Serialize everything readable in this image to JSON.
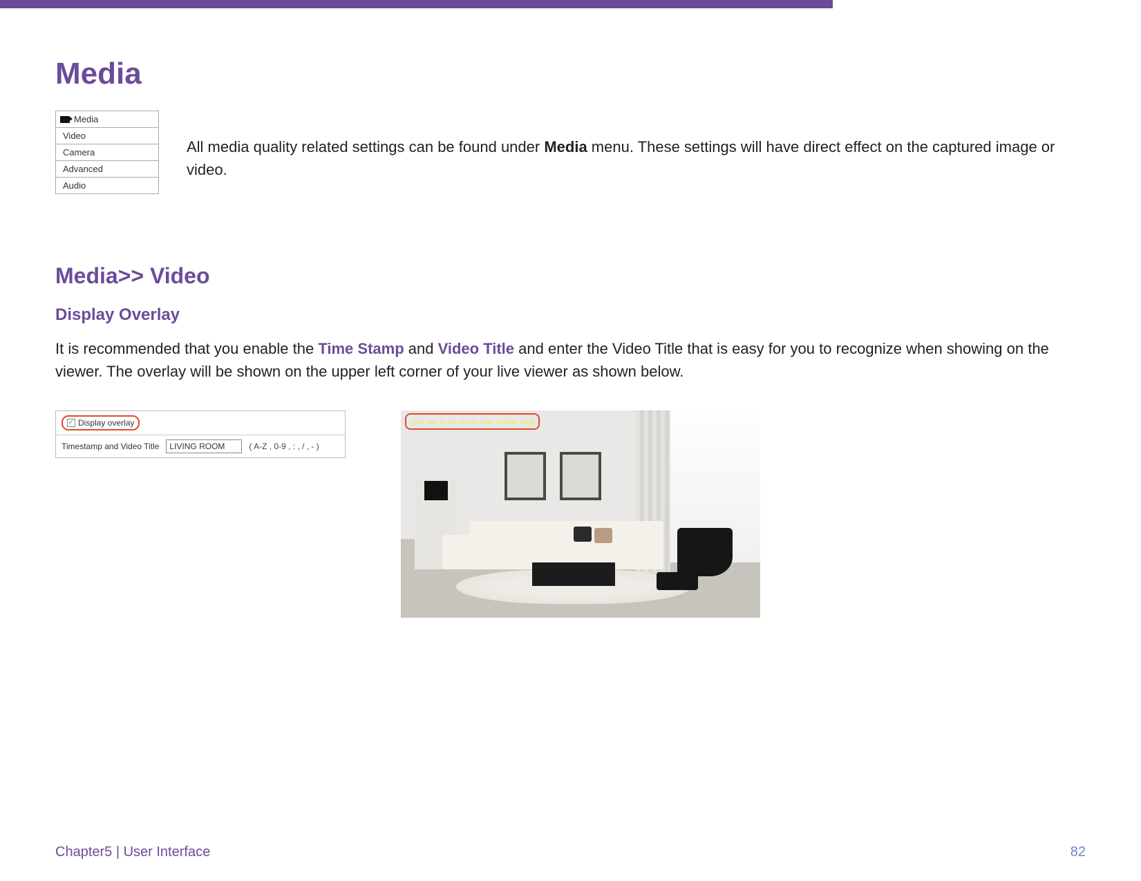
{
  "title": "Media",
  "menu": {
    "header": "Media",
    "items": [
      "Video",
      "Camera",
      "Advanced",
      "Audio"
    ]
  },
  "intro": {
    "pre": "All media quality related settings can be found under ",
    "bold": "Media",
    "post": " menu. These settings will have direct effect on the captured image or video."
  },
  "subhead": "Media>> Video",
  "section": "Display Overlay",
  "para": {
    "p1": "It is recommended that you enable the ",
    "h1": "Time Stamp",
    "p2": " and ",
    "h2": "Video Title",
    "p3": " and enter the Video Title that is easy for you to recognize when showing on the viewer. The overlay will be shown on the upper left corner of your live viewer as shown below."
  },
  "settings": {
    "checkbox_label": "Display overlay",
    "checkbox_mark": "✓",
    "row_label": "Timestamp and Video Title",
    "field_value": "LIVING ROOM",
    "hint": "( A-Z , 0-9 , : , / , - )"
  },
  "overlay_ts": "2014-06-17 02:07:25 TUE  LIVING ROOM",
  "footer": {
    "left": "Chapter5  |  User Interface",
    "page": "82"
  }
}
